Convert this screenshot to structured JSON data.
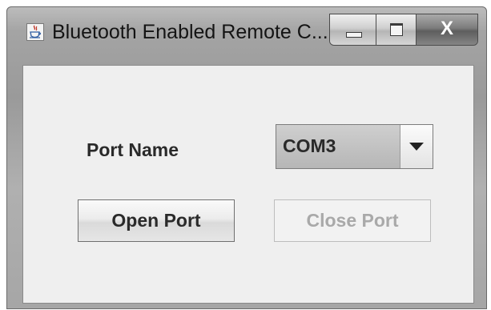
{
  "window": {
    "title": "Bluetooth Enabled Remote C...",
    "controls": {
      "minimize": "minimize",
      "maximize": "maximize",
      "close_glyph": "X"
    }
  },
  "form": {
    "port_name_label": "Port Name",
    "port_select": {
      "selected": "COM3"
    },
    "open_port_label": "Open Port",
    "close_port_label": "Close Port",
    "close_port_enabled": false
  },
  "icons": {
    "app": "java-coffee-cup-icon",
    "dropdown": "chevron-down-icon"
  }
}
